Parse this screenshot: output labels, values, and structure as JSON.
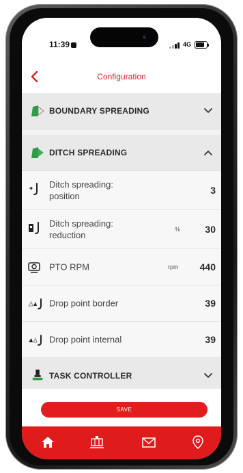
{
  "status": {
    "time": "11:39",
    "network": "4G"
  },
  "header": {
    "title": "Configuration"
  },
  "sections": [
    {
      "label": "BOUNDARY SPREADING",
      "icon": "spreader-boundary-icon",
      "expanded": false
    },
    {
      "label": "DITCH SPREADING",
      "icon": "spreader-ditch-icon",
      "expanded": true
    },
    {
      "label": "TASK CONTROLLER",
      "icon": "task-controller-icon",
      "expanded": false
    }
  ],
  "rows": [
    {
      "label": "Ditch spreading: position",
      "unit": "",
      "value": "3",
      "icon": "ditch-position-icon"
    },
    {
      "label": "Ditch spreading: reduction",
      "unit": "%",
      "value": "30",
      "icon": "ditch-reduction-icon"
    },
    {
      "label": "PTO RPM",
      "unit": "rpm",
      "value": "440",
      "icon": "pto-icon"
    },
    {
      "label": "Drop point border",
      "unit": "",
      "value": "39",
      "icon": "drop-point-border-icon"
    },
    {
      "label": "Drop point internal",
      "unit": "",
      "value": "39",
      "icon": "drop-point-internal-icon"
    }
  ],
  "save_label": "SAVE",
  "tabs": [
    "home-icon",
    "machine-icon",
    "mail-icon",
    "location-pin-icon"
  ],
  "colors": {
    "accent": "#e01b1b",
    "spreader_green": "#2e9e45"
  }
}
